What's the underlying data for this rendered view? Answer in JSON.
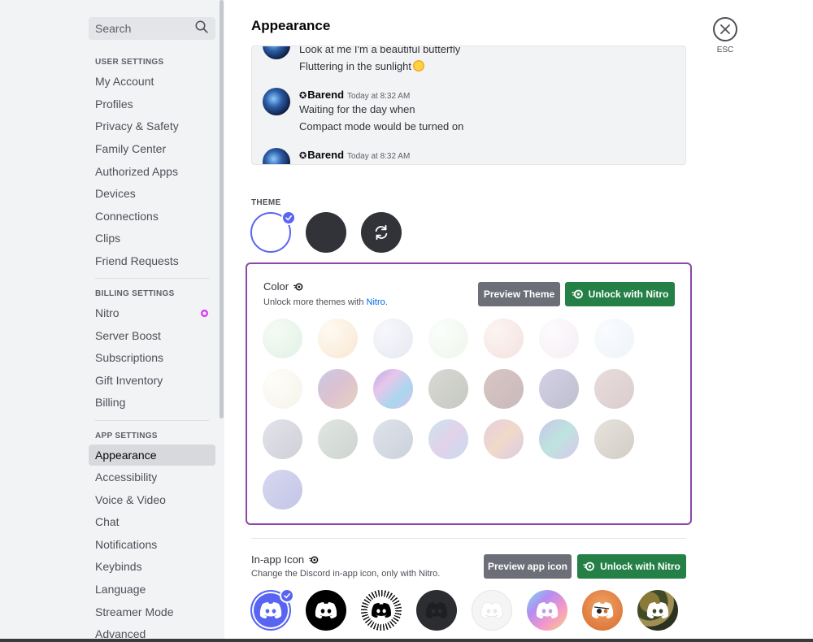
{
  "sidebar": {
    "search_placeholder": "Search",
    "sections": [
      {
        "header": "USER SETTINGS",
        "items": [
          "My Account",
          "Profiles",
          "Privacy & Safety",
          "Family Center",
          "Authorized Apps",
          "Devices",
          "Connections",
          "Clips",
          "Friend Requests"
        ]
      },
      {
        "header": "BILLING SETTINGS",
        "items": [
          "Nitro",
          "Server Boost",
          "Subscriptions",
          "Gift Inventory",
          "Billing"
        ]
      },
      {
        "header": "APP SETTINGS",
        "items": [
          "Appearance",
          "Accessibility",
          "Voice & Video",
          "Chat",
          "Notifications",
          "Keybinds",
          "Language",
          "Streamer Mode",
          "Advanced"
        ]
      }
    ],
    "active_item": "Appearance"
  },
  "main": {
    "title": "Appearance",
    "close_label": "ESC",
    "preview": {
      "messages": [
        {
          "lines": [
            "Look at me I'm a beautiful butterfly",
            "Fluttering in the sunlight"
          ]
        },
        {
          "author": "Barend",
          "time": "Today at 8:32 AM",
          "lines": [
            "Waiting for the day when",
            "Compact mode would be turned on"
          ]
        },
        {
          "author": "Barend",
          "time": "Today at 8:32 AM",
          "lines": []
        }
      ]
    },
    "theme": {
      "label": "THEME",
      "selected": "light"
    },
    "color": {
      "title": "Color",
      "subtitle_prefix": "Unlock more themes with ",
      "subtitle_link": "Nitro",
      "subtitle_suffix": ".",
      "preview_button": "Preview Theme",
      "unlock_button": "Unlock with Nitro"
    },
    "app_icon": {
      "title": "In-app Icon",
      "subtitle": "Change the Discord in-app icon, only with Nitro.",
      "preview_button": "Preview app icon",
      "unlock_button": "Unlock with Nitro"
    }
  },
  "colors": {
    "accent": "#5865f2",
    "nitro_green": "#248046",
    "nitro_border": "#8a47a8"
  }
}
